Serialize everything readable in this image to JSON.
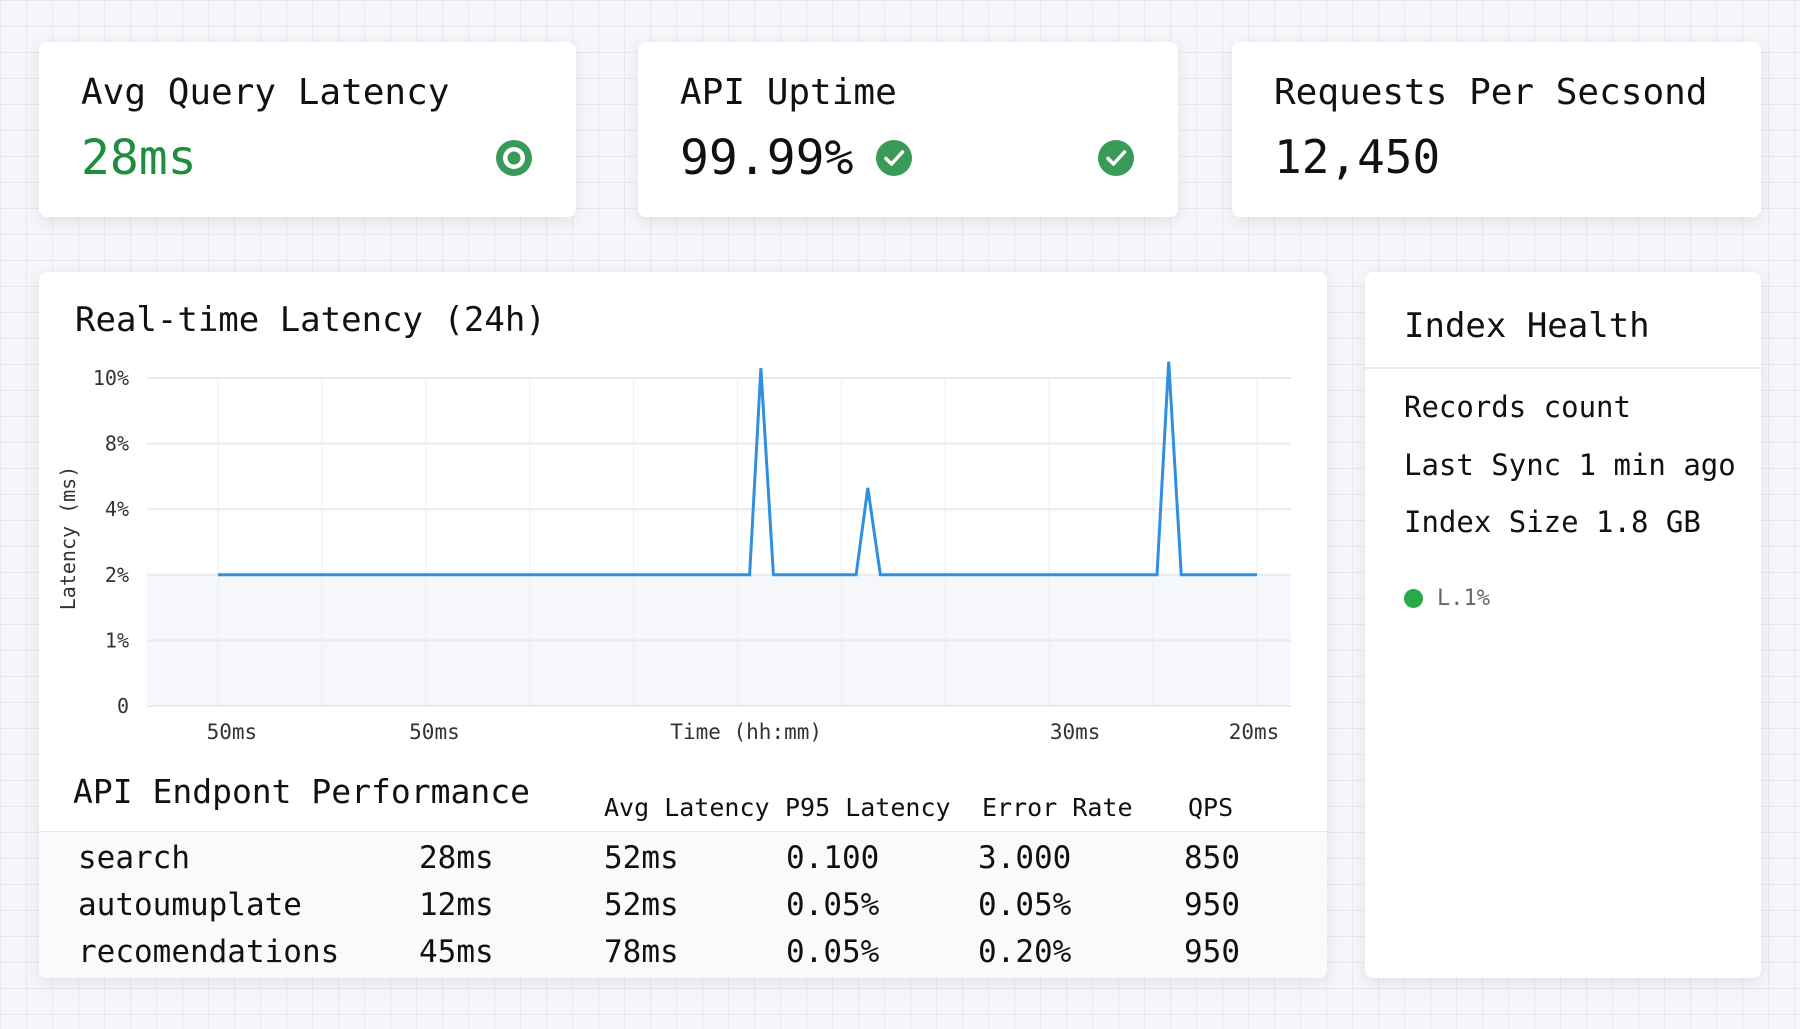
{
  "kpis": [
    {
      "title": "Avg Query Latency",
      "value": "28ms",
      "icon": "target-icon"
    },
    {
      "title": "API Uptime",
      "value": "99.99%",
      "icon": "check-circle-icon"
    },
    {
      "title": "Requests Per Secsond",
      "value": "12,450"
    }
  ],
  "colors": {
    "green": "#1e8e3e",
    "icon_green": "#3a9a5a",
    "line": "#2f8fe0",
    "dot": "#2aa84a"
  },
  "chart_data": {
    "type": "line",
    "title": "Real-time Latency (24h)",
    "xlabel": "Time (hh:mm)",
    "ylabel": "Latency (ms)",
    "ytick_labels": [
      "0",
      "1%",
      "2%",
      "4%",
      "8%",
      "10%"
    ],
    "ytick_values": [
      0,
      1,
      2,
      4,
      8,
      10
    ],
    "xlim": [
      0,
      24
    ],
    "xticks": [
      {
        "x": 0.16,
        "label": "50ms"
      },
      {
        "x": 5.0,
        "label": "50ms"
      },
      {
        "x": 12.2,
        "label": "Time (hh:mm)"
      },
      {
        "x": 19.8,
        "label": "30ms"
      },
      {
        "x": 24,
        "label": "20ms"
      }
    ],
    "grid": true,
    "series": [
      {
        "name": "latency",
        "x": [
          0,
          12.28,
          12.54,
          12.83,
          14.74,
          15.01,
          15.3,
          21.69,
          21.96,
          22.25,
          24
        ],
        "y": [
          2,
          2,
          10.3,
          2,
          2,
          5.3,
          2,
          2,
          10.5,
          2,
          2
        ]
      }
    ]
  },
  "table": {
    "title": "API Endpont Performance",
    "headers": [
      "Avg Latency",
      "P95 Latency",
      "Error Rate",
      "QPS"
    ],
    "rows": [
      [
        "search",
        "28ms",
        "52ms",
        "0.100",
        "3.000",
        "850"
      ],
      [
        "autoumuplate",
        "12ms",
        "52ms",
        "0.05%",
        "0.05%",
        "950"
      ],
      [
        "recomendations",
        "45ms",
        "78ms",
        "0.05%",
        "0.20%",
        "950"
      ]
    ]
  },
  "index_health": {
    "title": "Index Health",
    "rows": [
      "Records count",
      "Last Sync 1 min ago",
      "Index Size 1.8 GB"
    ],
    "status": "L.1%"
  }
}
